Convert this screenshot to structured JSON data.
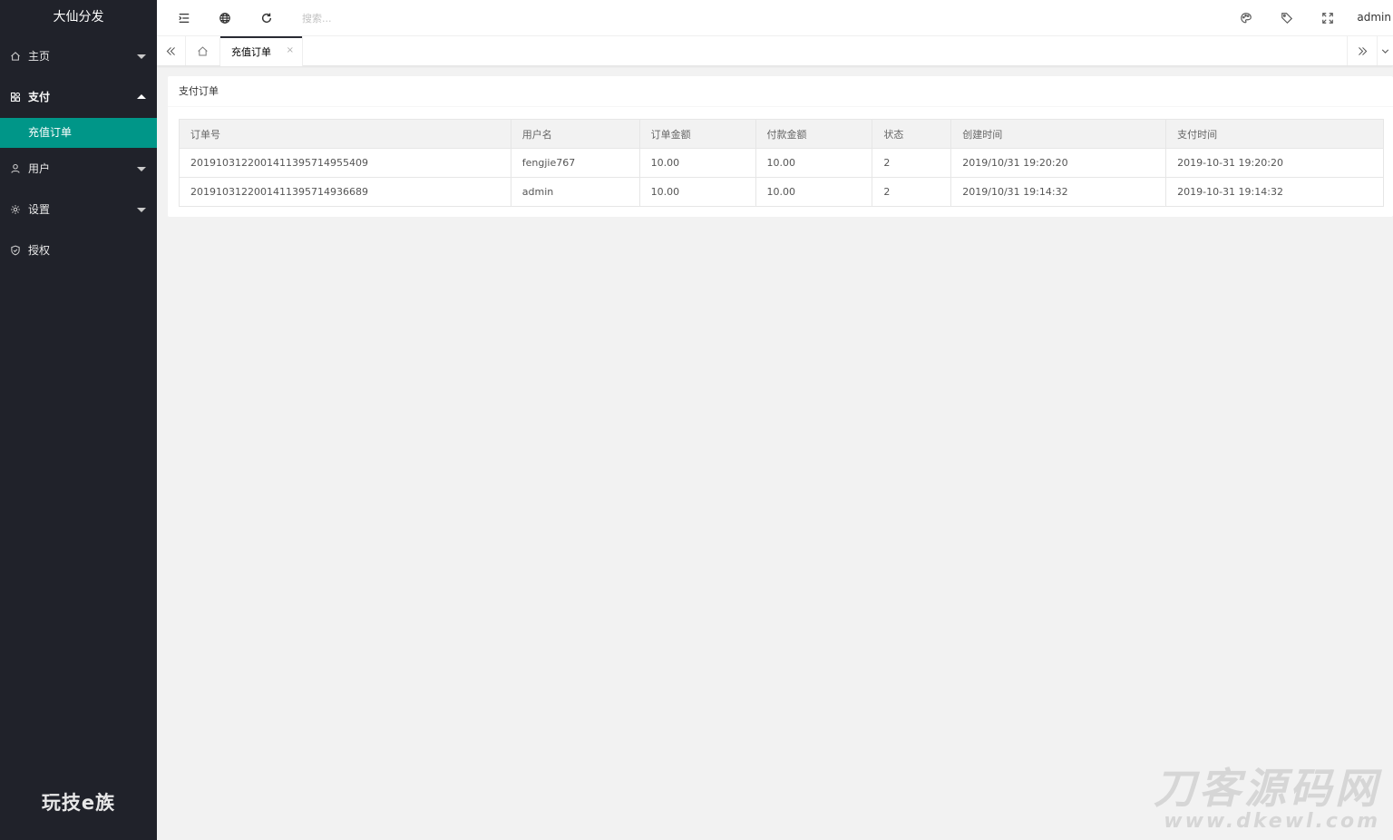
{
  "sidebar": {
    "logo": "大仙分发",
    "items": [
      {
        "label": "主页",
        "icon": "home-icon",
        "arrow": "down"
      },
      {
        "label": "支付",
        "icon": "apps-icon",
        "arrow": "up"
      },
      {
        "label": "用户",
        "icon": "user-icon",
        "arrow": "down"
      },
      {
        "label": "设置",
        "icon": "gear-icon",
        "arrow": "down"
      },
      {
        "label": "授权",
        "icon": "shield-icon",
        "arrow": ""
      }
    ],
    "sub_item": "充值订单",
    "footer_brand": "玩技e族"
  },
  "header": {
    "search_placeholder": "搜索...",
    "user": "admin"
  },
  "tabs": {
    "current": "充值订单",
    "close_glyph": "×"
  },
  "card": {
    "title": "支付订单",
    "columns": [
      "订单号",
      "用户名",
      "订单金额",
      "付款金额",
      "状态",
      "创建时间",
      "支付时间"
    ],
    "rows": [
      [
        "20191031220014113957149554​09",
        "fengjie767",
        "10.00",
        "10.00",
        "2",
        "2019/10/31 19:20:20",
        "2019-10-31 19:20:20"
      ],
      [
        "201910312200141139571493668​9",
        "admin",
        "10.00",
        "10.00",
        "2",
        "2019/10/31 19:14:32",
        "2019-10-31 19:14:32"
      ]
    ]
  },
  "watermark": {
    "line1": "刀客源码网",
    "line2": "www.dkewl.com"
  },
  "colors": {
    "sidebar_bg": "#20222a",
    "accent": "#009688",
    "content_bg": "#f2f2f2"
  }
}
